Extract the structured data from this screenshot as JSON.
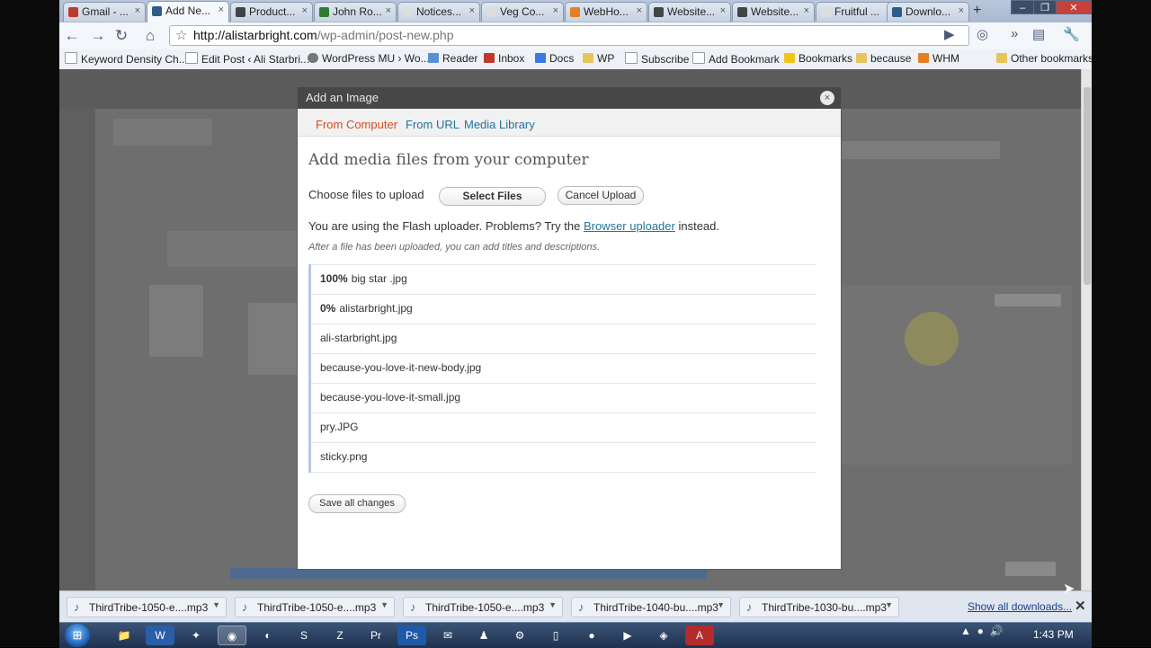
{
  "browser": {
    "tabs": [
      {
        "label": "Gmail - ...",
        "favicon_color": "#c0392b"
      },
      {
        "label": "Add Ne...",
        "favicon_color": "#2b5c8a"
      },
      {
        "label": "Product...",
        "favicon_color": "#444"
      },
      {
        "label": "John Ro...",
        "favicon_color": "#2e7d32"
      },
      {
        "label": "Notices...",
        "favicon_color": "#ddd"
      },
      {
        "label": "Veg Co...",
        "favicon_color": "#ddd"
      },
      {
        "label": "WebHo...",
        "favicon_color": "#e67e22"
      },
      {
        "label": "Website...",
        "favicon_color": "#444"
      },
      {
        "label": "Website...",
        "favicon_color": "#444"
      },
      {
        "label": "Fruitful ...",
        "favicon_color": "#ddd"
      },
      {
        "label": "Downlo...",
        "favicon_color": "#2b5c8a"
      }
    ],
    "new_tab": "+",
    "address_host": "http://alistarbright.com",
    "address_path": "/wp-admin/post-new.php",
    "bookmarks": [
      "Keyword Density Ch...",
      "Edit Post ‹ Ali Starbri...",
      "WordPress MU › Wo...",
      "Reader",
      "Inbox",
      "Docs",
      "WP",
      "Subscribe",
      "Add Bookmark",
      "Bookmarks",
      "because",
      "WHM",
      "Other bookmarks"
    ]
  },
  "modal": {
    "title": "Add an Image",
    "close": "×",
    "tabs": [
      "From Computer",
      "From URL",
      "Media Library"
    ],
    "heading": "Add media files from your computer",
    "choose_label": "Choose files to upload",
    "select_files": "Select Files",
    "cancel_upload": "Cancel Upload",
    "flash_note_pre": "You are using the Flash uploader. Problems? Try the",
    "flash_note_link": "Browser uploader",
    "flash_note_post": "instead.",
    "hint": "After a file has been uploaded, you can add titles and descriptions.",
    "files": [
      {
        "pct": "100%",
        "name": "big star .jpg"
      },
      {
        "pct": "0%",
        "name": "alistarbright.jpg"
      },
      {
        "pct": "",
        "name": "ali-starbright.jpg"
      },
      {
        "pct": "",
        "name": "because-you-love-it-new-body.jpg"
      },
      {
        "pct": "",
        "name": "because-you-love-it-small.jpg"
      },
      {
        "pct": "",
        "name": "pry.JPG"
      },
      {
        "pct": "",
        "name": "sticky.png"
      }
    ],
    "save_all": "Save all changes"
  },
  "downloads": {
    "items": [
      "ThirdTribe-1050-e....mp3",
      "ThirdTribe-1050-e....mp3",
      "ThirdTribe-1050-e....mp3",
      "ThirdTribe-1040-bu....mp3",
      "ThirdTribe-1030-bu....mp3"
    ],
    "show_all": "Show all downloads...",
    "close": "✕"
  },
  "taskbar": {
    "clock": "1:43 PM"
  }
}
